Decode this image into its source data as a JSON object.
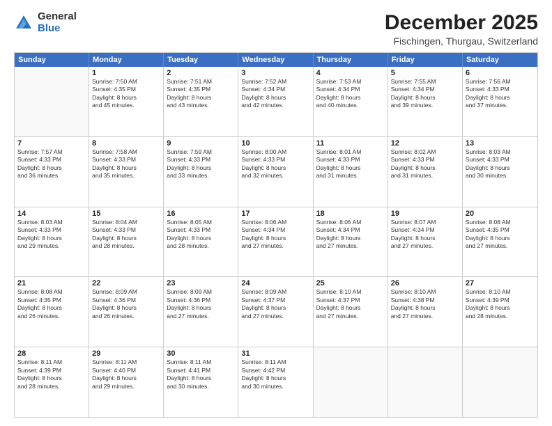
{
  "logo": {
    "general": "General",
    "blue": "Blue"
  },
  "header": {
    "title": "December 2025",
    "subtitle": "Fischingen, Thurgau, Switzerland"
  },
  "weekdays": [
    "Sunday",
    "Monday",
    "Tuesday",
    "Wednesday",
    "Thursday",
    "Friday",
    "Saturday"
  ],
  "weeks": [
    [
      {
        "day": "",
        "content": ""
      },
      {
        "day": "1",
        "content": "Sunrise: 7:50 AM\nSunset: 4:35 PM\nDaylight: 8 hours\nand 45 minutes."
      },
      {
        "day": "2",
        "content": "Sunrise: 7:51 AM\nSunset: 4:35 PM\nDaylight: 8 hours\nand 43 minutes."
      },
      {
        "day": "3",
        "content": "Sunrise: 7:52 AM\nSunset: 4:34 PM\nDaylight: 8 hours\nand 42 minutes."
      },
      {
        "day": "4",
        "content": "Sunrise: 7:53 AM\nSunset: 4:34 PM\nDaylight: 8 hours\nand 40 minutes."
      },
      {
        "day": "5",
        "content": "Sunrise: 7:55 AM\nSunset: 4:34 PM\nDaylight: 8 hours\nand 39 minutes."
      },
      {
        "day": "6",
        "content": "Sunrise: 7:56 AM\nSunset: 4:33 PM\nDaylight: 8 hours\nand 37 minutes."
      }
    ],
    [
      {
        "day": "7",
        "content": "Sunrise: 7:57 AM\nSunset: 4:33 PM\nDaylight: 8 hours\nand 36 minutes."
      },
      {
        "day": "8",
        "content": "Sunrise: 7:58 AM\nSunset: 4:33 PM\nDaylight: 8 hours\nand 35 minutes."
      },
      {
        "day": "9",
        "content": "Sunrise: 7:59 AM\nSunset: 4:33 PM\nDaylight: 8 hours\nand 33 minutes."
      },
      {
        "day": "10",
        "content": "Sunrise: 8:00 AM\nSunset: 4:33 PM\nDaylight: 8 hours\nand 32 minutes."
      },
      {
        "day": "11",
        "content": "Sunrise: 8:01 AM\nSunset: 4:33 PM\nDaylight: 8 hours\nand 31 minutes."
      },
      {
        "day": "12",
        "content": "Sunrise: 8:02 AM\nSunset: 4:33 PM\nDaylight: 8 hours\nand 31 minutes."
      },
      {
        "day": "13",
        "content": "Sunrise: 8:03 AM\nSunset: 4:33 PM\nDaylight: 8 hours\nand 30 minutes."
      }
    ],
    [
      {
        "day": "14",
        "content": "Sunrise: 8:03 AM\nSunset: 4:33 PM\nDaylight: 8 hours\nand 29 minutes."
      },
      {
        "day": "15",
        "content": "Sunrise: 8:04 AM\nSunset: 4:33 PM\nDaylight: 8 hours\nand 28 minutes."
      },
      {
        "day": "16",
        "content": "Sunrise: 8:05 AM\nSunset: 4:33 PM\nDaylight: 8 hours\nand 28 minutes."
      },
      {
        "day": "17",
        "content": "Sunrise: 8:06 AM\nSunset: 4:34 PM\nDaylight: 8 hours\nand 27 minutes."
      },
      {
        "day": "18",
        "content": "Sunrise: 8:06 AM\nSunset: 4:34 PM\nDaylight: 8 hours\nand 27 minutes."
      },
      {
        "day": "19",
        "content": "Sunrise: 8:07 AM\nSunset: 4:34 PM\nDaylight: 8 hours\nand 27 minutes."
      },
      {
        "day": "20",
        "content": "Sunrise: 8:08 AM\nSunset: 4:35 PM\nDaylight: 8 hours\nand 27 minutes."
      }
    ],
    [
      {
        "day": "21",
        "content": "Sunrise: 8:08 AM\nSunset: 4:35 PM\nDaylight: 8 hours\nand 26 minutes."
      },
      {
        "day": "22",
        "content": "Sunrise: 8:09 AM\nSunset: 4:36 PM\nDaylight: 8 hours\nand 26 minutes."
      },
      {
        "day": "23",
        "content": "Sunrise: 8:09 AM\nSunset: 4:36 PM\nDaylight: 8 hours\nand 27 minutes."
      },
      {
        "day": "24",
        "content": "Sunrise: 8:09 AM\nSunset: 4:37 PM\nDaylight: 8 hours\nand 27 minutes."
      },
      {
        "day": "25",
        "content": "Sunrise: 8:10 AM\nSunset: 4:37 PM\nDaylight: 8 hours\nand 27 minutes."
      },
      {
        "day": "26",
        "content": "Sunrise: 8:10 AM\nSunset: 4:38 PM\nDaylight: 8 hours\nand 27 minutes."
      },
      {
        "day": "27",
        "content": "Sunrise: 8:10 AM\nSunset: 4:39 PM\nDaylight: 8 hours\nand 28 minutes."
      }
    ],
    [
      {
        "day": "28",
        "content": "Sunrise: 8:11 AM\nSunset: 4:39 PM\nDaylight: 8 hours\nand 28 minutes."
      },
      {
        "day": "29",
        "content": "Sunrise: 8:11 AM\nSunset: 4:40 PM\nDaylight: 8 hours\nand 29 minutes."
      },
      {
        "day": "30",
        "content": "Sunrise: 8:11 AM\nSunset: 4:41 PM\nDaylight: 8 hours\nand 30 minutes."
      },
      {
        "day": "31",
        "content": "Sunrise: 8:11 AM\nSunset: 4:42 PM\nDaylight: 8 hours\nand 30 minutes."
      },
      {
        "day": "",
        "content": ""
      },
      {
        "day": "",
        "content": ""
      },
      {
        "day": "",
        "content": ""
      }
    ]
  ]
}
